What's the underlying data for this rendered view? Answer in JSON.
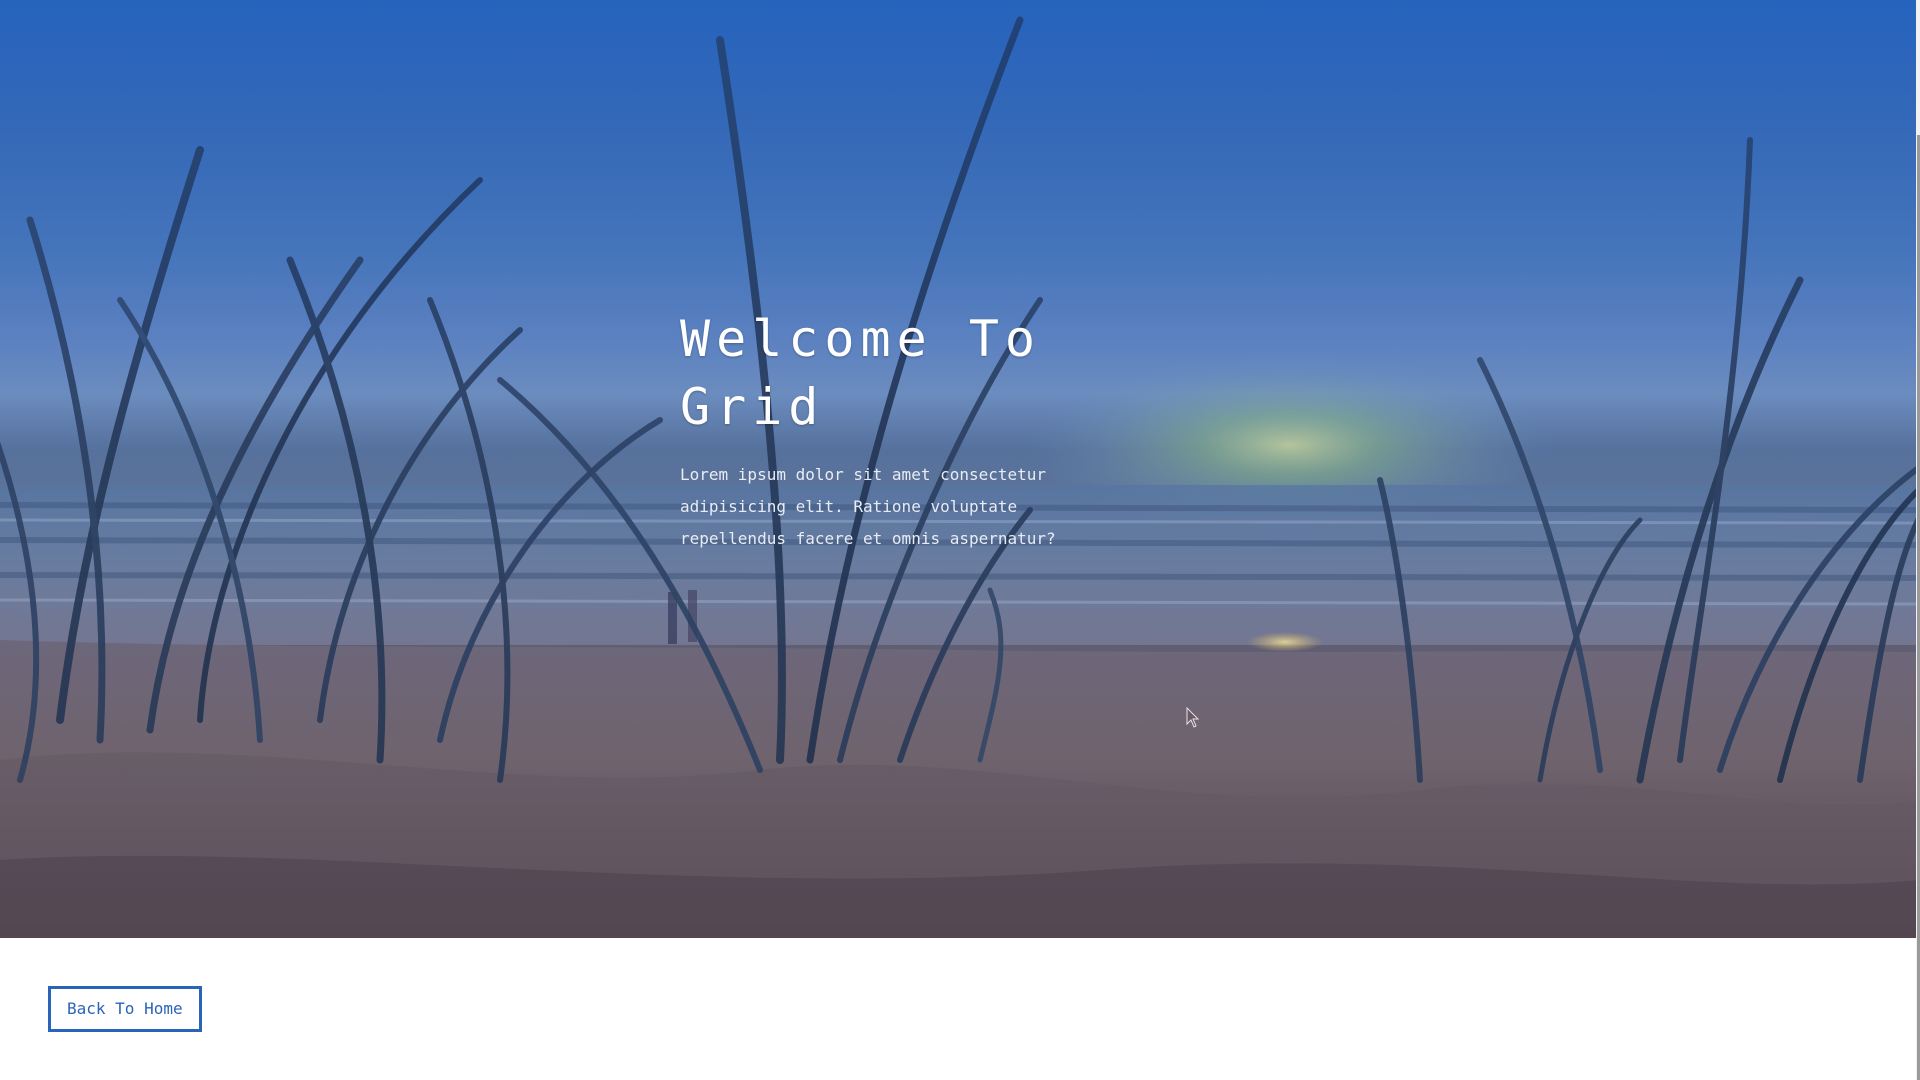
{
  "hero": {
    "title": "Welcome To Grid",
    "text": "Lorem ipsum dolor sit amet consectetur adipisicing elit. Ratione voluptate repellendus facere et omnis aspernatur?"
  },
  "back_button": {
    "label": "Back To Home"
  },
  "colors": {
    "accent": "#2a64b8",
    "sky": "#2a68bd",
    "sand": "#6b5e66",
    "white": "#ffffff"
  },
  "icons": {
    "cursor": "mouse-pointer-icon"
  }
}
